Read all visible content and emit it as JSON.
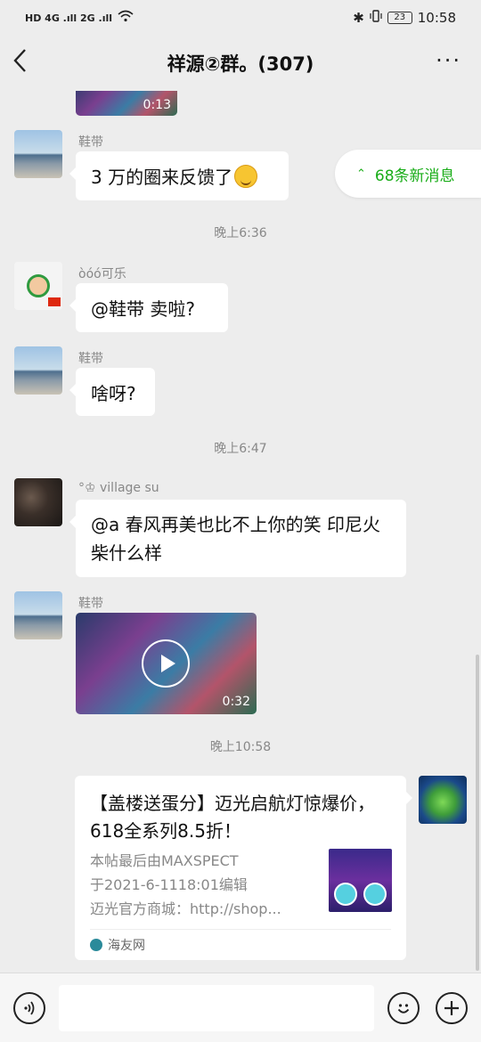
{
  "status_bar": {
    "left_indicators": "HD  4G .ıll  2G .ıll",
    "bluetooth": "✱",
    "battery": "23",
    "time": "10:58"
  },
  "header": {
    "back_glyph": "‹",
    "title": "祥源②群。(307)",
    "more_glyph": "···"
  },
  "new_messages": {
    "arrow": "⌃",
    "label": "68条新消息"
  },
  "messages": {
    "video_top_duration": "0:13",
    "m1_sender": "鞋带",
    "m1_text": "3 万的圈来反馈了",
    "time1": "晚上6:36",
    "m2_sender": "òóó可乐",
    "m2_text": "@鞋带  卖啦?",
    "m3_sender": "鞋带",
    "m3_text": "啥呀?",
    "time2": "晚上6:47",
    "m4_sender": "°♔ village  su",
    "m4_text": "@a 春风再美也比不上你的笑  印尼火柴什么样",
    "m5_sender": "鞋带",
    "m5_duration": "0:32",
    "time3": "晚上10:58"
  },
  "link_card": {
    "title": "【盖楼送蛋分】迈光启航灯惊爆价，618全系列8.5折！",
    "desc_line1": "本帖最后由MAXSPECT",
    "desc_line2": "于2021-6-1118:01编辑",
    "desc_line3": "迈光官方商城：http://shop...",
    "source": "海友网"
  },
  "input_bar": {
    "voice_icon": "voice-icon",
    "emoji_icon": "emoji-icon",
    "plus_icon": "plus-icon"
  }
}
